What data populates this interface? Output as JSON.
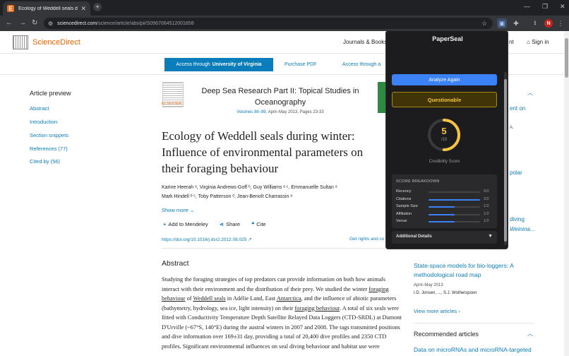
{
  "browser": {
    "tab_title": "Ecology of Weddell seals during",
    "url_domain": "sciencedirect.com",
    "url_path": "/science/article/abs/pii/S0967064512001658"
  },
  "header": {
    "logo": "ScienceDirect",
    "journals_books": "Journals & Books",
    "account_fragment": "nt",
    "sign_in": "Sign in"
  },
  "access": {
    "through_prefix": "Access through",
    "institution": "University of Virginia",
    "purchase_pdf": "Purchase PDF",
    "other_access": "Access through a"
  },
  "sidebar": {
    "title": "Article preview",
    "links": [
      "Abstract",
      "Introduction",
      "Section snippets",
      "References (77)",
      "Cited by (56)"
    ]
  },
  "article": {
    "publisher": "ELSEVIER",
    "journal": "Deep Sea Research Part II: Topical Studies in Oceanography",
    "volume_link": "Volumes 88–89",
    "volume_rest": ", April–May 2013, Pages 23-33",
    "title": "Ecology of Weddell seals during winter: Influence of environmental parameters on their foraging behaviour",
    "authors_line1": "Karine Heerah ᵃ, Virginia Andrews-Goff ᵇ, Guy Williams ᵃ ᶜ, Emmanuelle Sultan ᵃ",
    "authors_line2": "Mark Hindell ᵇ ᶜ, Toby Patterson ᵈ, Jean-Benoît Charrassin ᵃ",
    "show_more": "Show more",
    "add_mendeley": "Add to Mendeley",
    "share": "Share",
    "cite": "Cite",
    "doi": "https://doi.org/10.1016/j.dsr2.2012.08.025",
    "rights": "Get rights and co",
    "abstract_heading": "Abstract",
    "abstract_p1": "Studying the foraging strategies of top predators can provide information on both how animals interact with their environment and the distribution of their prey. We studied the winter ",
    "abstract_u1": "foraging behaviour",
    "abstract_p2": " of ",
    "abstract_u2": "Weddell seals",
    "abstract_p3": " in Adélie Land, East ",
    "abstract_u3": "Antarctica",
    "abstract_p4": ", and the influence of abiotic parameters (bathymetry, hydrology, sea ice, light intensity) on their ",
    "abstract_u4": "foraging behaviour",
    "abstract_p5": ". A total of six seals were fitted with Conductivity Temperature Depth Satellite Relayed Data Loggers (CTD-SRDL) at Dumont D'Urville (~67°S, 140°E) during the austral winters in 2007 and 2008. The tags transmitted positions and dive information over 169±31 day, providing a total of 20,400 dive profiles and 2350 CTD profiles. Significant environmental influences on seal diving behaviour and habitat use were"
  },
  "right_column": {
    "frag1": "ent on",
    "frag2": "A.",
    "frag3": "polar",
    "frag4": "diving",
    "frag5": "Weinina...",
    "card_title": "State-space models for bio-loggers: A methodological road map",
    "card_date": "April–May 2013",
    "card_authors": "I.D. Jonsen, ..., S.J. Wotherspoon",
    "view_more": "View more articles",
    "recommended": "Recommended articles",
    "next_title": "Data on microRNAs and microRNA-targeted"
  },
  "popup": {
    "title": "PaperSeal",
    "analyze_again": "Analyze Again",
    "verdict": "Questionable",
    "score": "5",
    "score_max": "/10",
    "score_fraction": 0.5,
    "credibility_label": "Credibility Score",
    "breakdown_title": "SCORE BREAKDOWN",
    "breakdown": [
      {
        "label": "Recency",
        "value": "0/2",
        "fraction": 0
      },
      {
        "label": "Citations",
        "value": "2/2",
        "fraction": 1
      },
      {
        "label": "Sample Size",
        "value": "1/2",
        "fraction": 0.5
      },
      {
        "label": "Affiliation",
        "value": "1/2",
        "fraction": 0.5
      },
      {
        "label": "Venue",
        "value": "1/2",
        "fraction": 0.5
      }
    ],
    "additional_details": "Additional Details"
  },
  "colors": {
    "accent_blue": "#3b82f6",
    "warning_yellow": "#f5c542",
    "elsevier_orange": "#eb6500",
    "link_blue": "#0c7dbb"
  }
}
